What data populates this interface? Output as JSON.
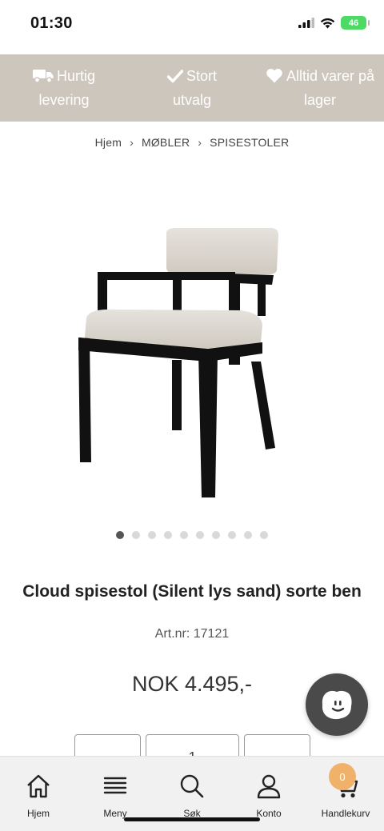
{
  "status_bar": {
    "time": "01:30",
    "battery": "46"
  },
  "usp": [
    {
      "icon": "truck-icon",
      "line1": "Hurtig",
      "line2": "levering"
    },
    {
      "icon": "checkmark-icon",
      "line1": "Stort",
      "line2": "utvalg"
    },
    {
      "icon": "heart-icon",
      "line1": "Alltid varer på",
      "line2": "lager"
    }
  ],
  "breadcrumb": {
    "home": "Hjem",
    "level1": "MØBLER",
    "level2": "SPISESTOLER",
    "separator": "›"
  },
  "carousel": {
    "total": 10,
    "active": 1
  },
  "product": {
    "title": "Cloud spisestol (Silent lys sand) sorte ben",
    "art_nr": "Art.nr: 17121",
    "price": "NOK 4.495,-",
    "quantity": "1",
    "seat_color": "#ddd8d0",
    "frame_color": "#111111"
  },
  "tabs": [
    {
      "icon": "home-icon",
      "label": "Hjem"
    },
    {
      "icon": "menu-icon",
      "label": "Meny"
    },
    {
      "icon": "search-icon",
      "label": "Søk"
    },
    {
      "icon": "user-icon",
      "label": "Konto"
    },
    {
      "icon": "cart-icon",
      "label": "Handlekurv",
      "badge": "0"
    }
  ],
  "colors": {
    "banner": "#cdc6bc",
    "badge": "#f0b26b",
    "chat": "#4a4a4a"
  }
}
